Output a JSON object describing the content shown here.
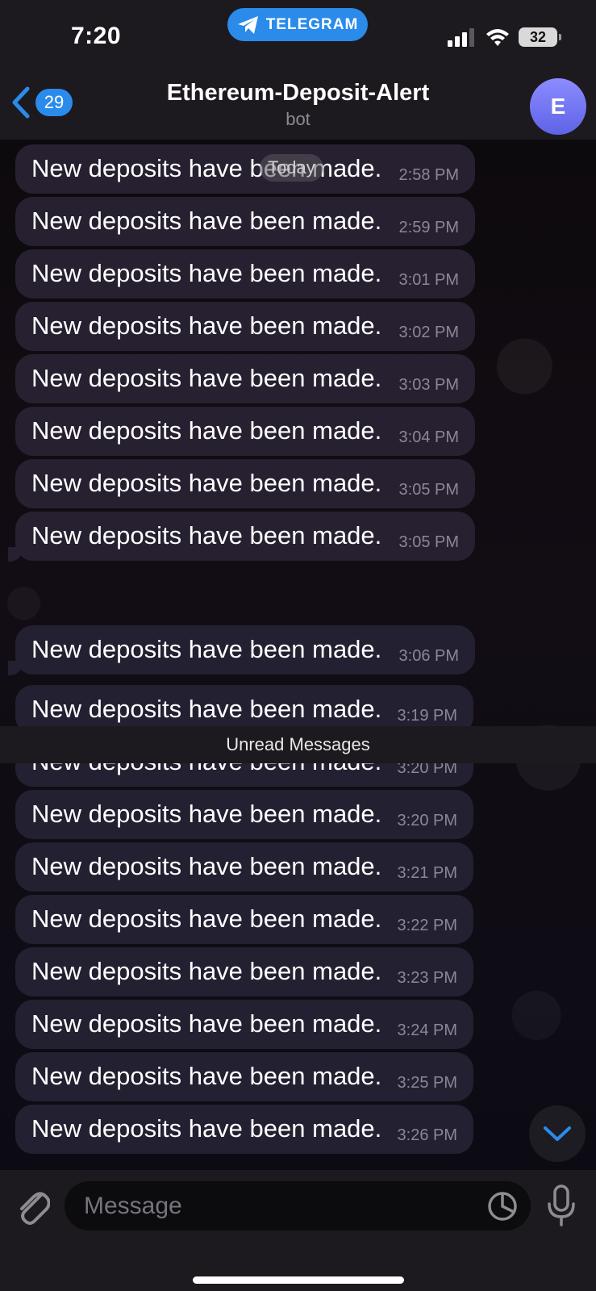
{
  "status_bar": {
    "time": "7:20",
    "app_pill": "TELEGRAM",
    "battery": "32"
  },
  "header": {
    "back_count": "29",
    "title": "Ethereum-Deposit-Alert",
    "subtitle": "bot",
    "avatar_letter": "E"
  },
  "date_pill": "Today",
  "unread_divider": "Unread Messages",
  "messages": [
    {
      "text": "New deposits have been made.",
      "time": "2:58 PM"
    },
    {
      "text": "New deposits have been made.",
      "time": "2:59 PM"
    },
    {
      "text": "New deposits have been made.",
      "time": "3:01 PM"
    },
    {
      "text": "New deposits have been made.",
      "time": "3:02 PM"
    },
    {
      "text": "New deposits have been made.",
      "time": "3:03 PM"
    },
    {
      "text": "New deposits have been made.",
      "time": "3:04 PM"
    },
    {
      "text": "New deposits have been made.",
      "time": "3:05 PM"
    },
    {
      "text": "New deposits have been made.",
      "time": "3:05 PM"
    },
    {
      "text": "New deposits have been made.",
      "time": "3:06 PM"
    },
    {
      "text": "New deposits have been made.",
      "time": "3:19 PM"
    },
    {
      "text": "New deposits have been made.",
      "time": "3:20 PM"
    },
    {
      "text": "New deposits have been made.",
      "time": "3:20 PM"
    },
    {
      "text": "New deposits have been made.",
      "time": "3:21 PM"
    },
    {
      "text": "New deposits have been made.",
      "time": "3:22 PM"
    },
    {
      "text": "New deposits have been made.",
      "time": "3:23 PM"
    },
    {
      "text": "New deposits have been made.",
      "time": "3:24 PM"
    },
    {
      "text": "New deposits have been made.",
      "time": "3:25 PM"
    },
    {
      "text": "New deposits have been made.",
      "time": "3:26 PM"
    }
  ],
  "input": {
    "placeholder": "Message"
  },
  "colors": {
    "accent": "#2a8bea",
    "bubble": "#272030",
    "bar": "#1c1a1f"
  }
}
